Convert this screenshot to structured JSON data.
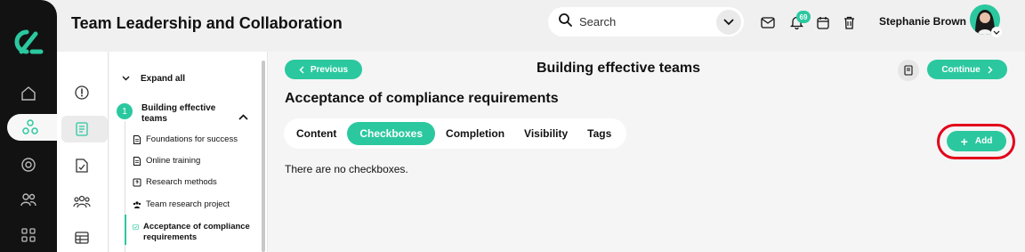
{
  "header": {
    "title": "Team Leadership and Collaboration",
    "search_placeholder": "Search",
    "notification_count": "69",
    "user_name": "Stephanie Brown"
  },
  "rail": {
    "icons": [
      "logo-icon",
      "home-icon",
      "network-icon",
      "target-icon",
      "users-icon",
      "grid-icon"
    ]
  },
  "course_nav": {
    "expand_all": "Expand all",
    "section": {
      "number": "1",
      "title": "Building effective teams"
    },
    "lessons": [
      {
        "label": "Foundations for success",
        "icon": "document-icon"
      },
      {
        "label": "Online training",
        "icon": "document-icon"
      },
      {
        "label": "Research methods",
        "icon": "question-doc-icon"
      },
      {
        "label": "Team research project",
        "icon": "team-icon"
      },
      {
        "label": "Acceptance of compliance requirements",
        "icon": "checkbox-icon",
        "active": true
      }
    ]
  },
  "main": {
    "prev_label": "Previous",
    "page_title": "Building effective teams",
    "continue_label": "Continue",
    "sub_title": "Acceptance of compliance requirements",
    "tabs": [
      {
        "label": "Content"
      },
      {
        "label": "Checkboxes",
        "active": true
      },
      {
        "label": "Completion"
      },
      {
        "label": "Visibility"
      },
      {
        "label": "Tags"
      }
    ],
    "empty_message": "There are no checkboxes.",
    "add_label": "Add"
  },
  "colors": {
    "accent": "#2bc89f",
    "highlight_ring": "#e2001a",
    "rail": "#121212"
  }
}
